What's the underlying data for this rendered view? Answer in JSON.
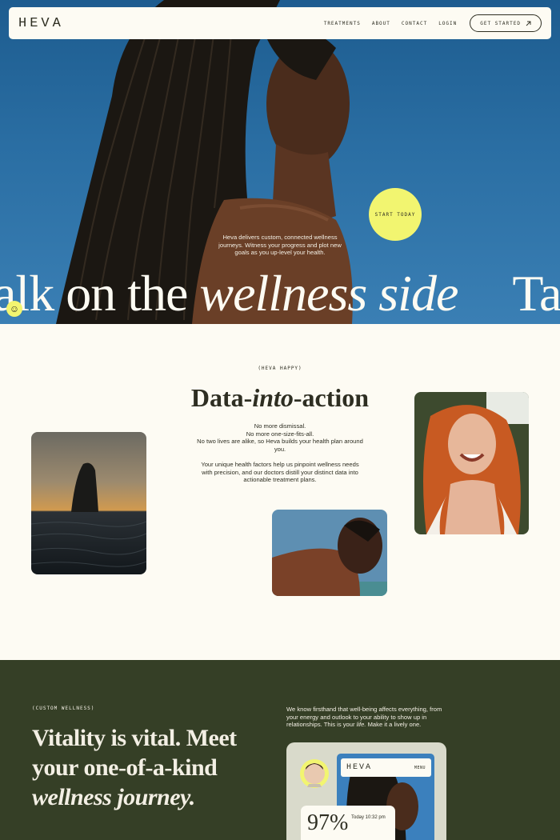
{
  "nav": {
    "logo": "HEVA",
    "links": [
      "TREATMENTS",
      "ABOUT",
      "CONTACT",
      "LOGIN"
    ],
    "cta_label": "GET STARTED",
    "cta_icon": "arrow-up-right-icon"
  },
  "hero": {
    "start_today": "START TODAY",
    "description": "Heva delivers custom, connected wellness journeys. Witness your progress and plot new goals as you up-level your health.",
    "marquee_start": "alk on the ",
    "marquee_italic": "wellness side",
    "marquee_end": "Take",
    "badge_icon": "smiley-icon"
  },
  "data_section": {
    "eyebrow": "(HEVA HAPPY)",
    "title_start": "Data-",
    "title_italic": "into",
    "title_end": "-action",
    "paragraph_1": "No more dismissal.\nNo more one-size-fits-all.\nNo two lives are alike, so Heva builds your health plan around you.",
    "paragraph_2": "Your unique health factors help us pinpoint wellness needs with precision, and our doctors distill your distinct data into actionable treatment plans."
  },
  "wellness": {
    "eyebrow": "(CUSTOM WELLNESS)",
    "title_line_1": "Vitality is vital. Meet",
    "title_line_2": "your one-of-a-kind",
    "title_line_3": "wellness journey.",
    "copy_start": "We know firsthand that well-being affects everything, from your energy and outlook to your ability to show up in relationships. This is your ",
    "copy_italic": "life.",
    "copy_end": " Make it a lively one.",
    "device": {
      "logo": "HEVA",
      "menu": "MENU",
      "stat_value": "97%",
      "stat_time": "Today  10:32 pm"
    }
  },
  "colors": {
    "cream": "#fdfbf3",
    "ink": "#2e2e22",
    "yellow": "#f2f570",
    "olive": "#353f26",
    "sky": "#2a6ea3"
  }
}
